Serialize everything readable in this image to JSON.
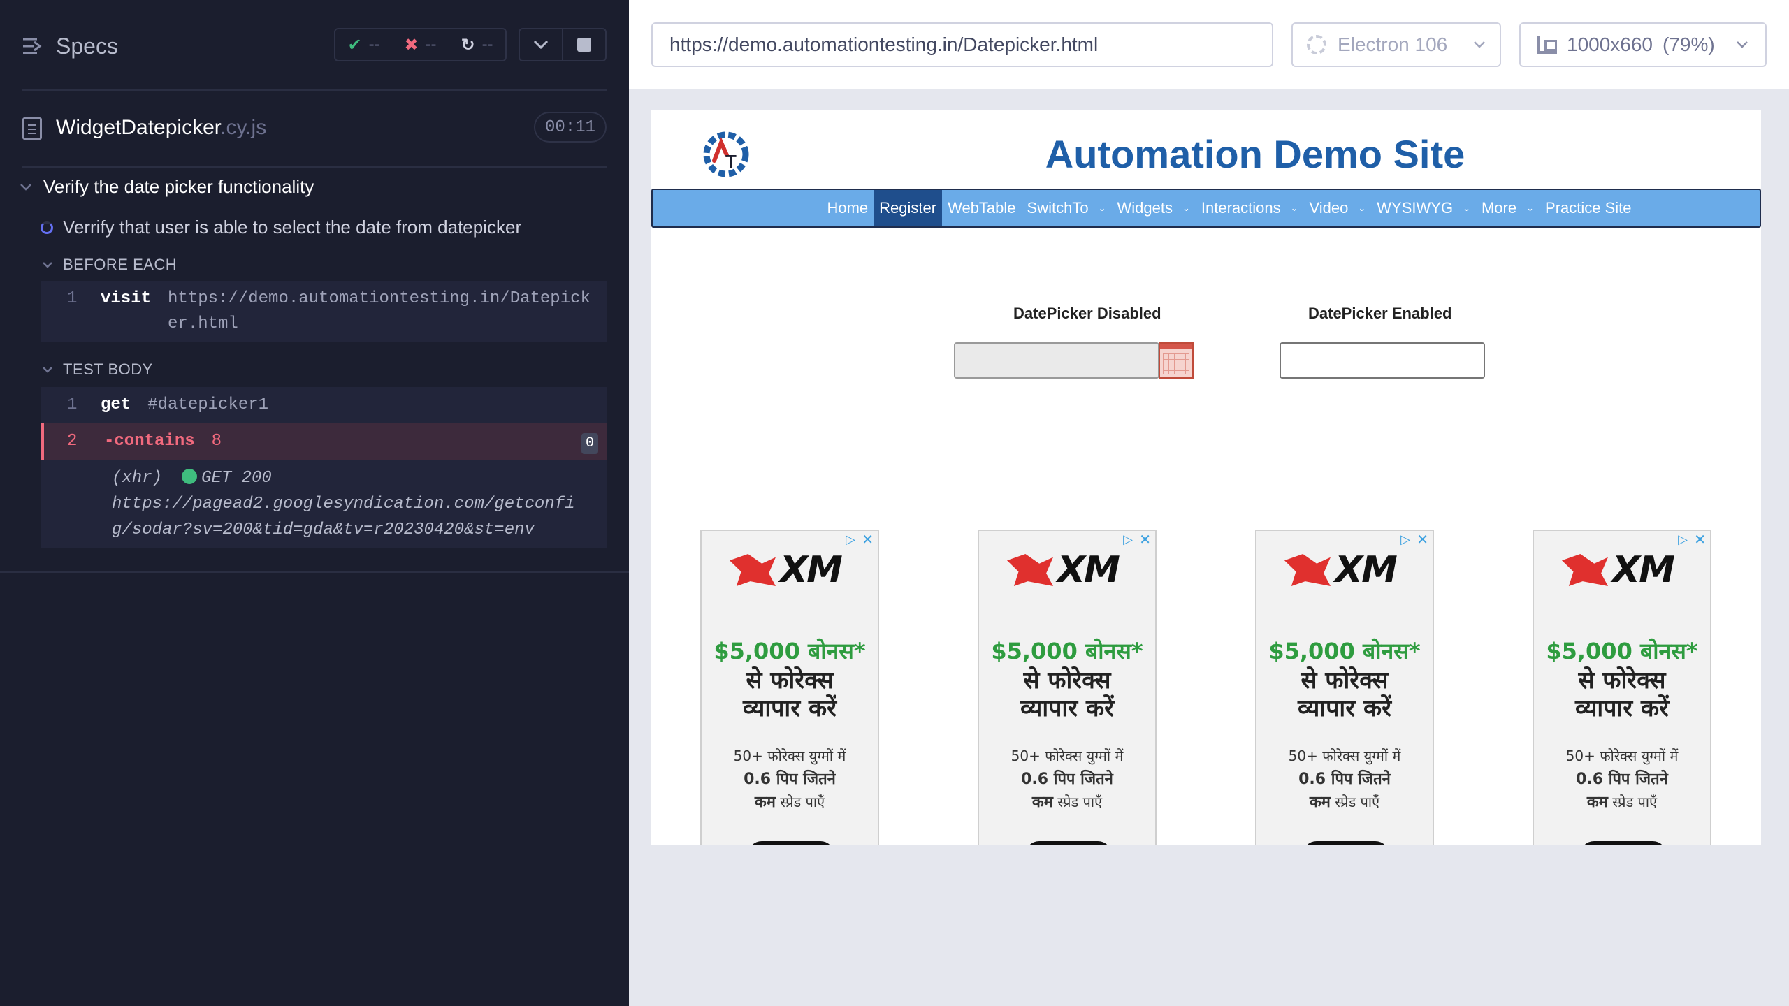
{
  "reporter": {
    "title": "Specs",
    "stats": {
      "passed": "--",
      "failed": "--",
      "pending": "--"
    },
    "spec": {
      "name": "WidgetDatepicker",
      "ext": ".cy.js",
      "duration": "00:11"
    },
    "suite_title": "Verify the date picker functionality",
    "test_title": "Verrify that user is able to select the date from datepicker",
    "before_each": {
      "label": "BEFORE EACH",
      "commands": [
        {
          "num": "1",
          "name": "visit",
          "message": "https://demo.automationtesting.in/Datepicker.html"
        }
      ]
    },
    "test_body": {
      "label": "TEST BODY",
      "commands": [
        {
          "num": "1",
          "name": "get",
          "message": "#datepicker1"
        },
        {
          "num": "2",
          "name": "-contains",
          "message": "8",
          "badge": "0"
        }
      ],
      "xhr": {
        "type": "(xhr)",
        "status": "GET 200",
        "url": "https://pagead2.googlesyndication.com/getconfig/sodar?sv=200&tid=gda&tv=r20230420&st=env"
      }
    }
  },
  "aut_header": {
    "url": "https://demo.automationtesting.in/Datepicker.html",
    "browser": "Electron 106",
    "viewport": "1000x660",
    "zoom": "(79%)"
  },
  "site": {
    "title": "Automation Demo Site",
    "nav": [
      {
        "label": "Home",
        "dropdown": false
      },
      {
        "label": "Register",
        "dropdown": false,
        "active": true
      },
      {
        "label": "WebTable",
        "dropdown": false
      },
      {
        "label": "SwitchTo",
        "dropdown": true
      },
      {
        "label": "Widgets",
        "dropdown": true
      },
      {
        "label": "Interactions",
        "dropdown": true
      },
      {
        "label": "Video",
        "dropdown": true
      },
      {
        "label": "WYSIWYG",
        "dropdown": true
      },
      {
        "label": "More",
        "dropdown": true
      },
      {
        "label": "Practice Site",
        "dropdown": false
      }
    ],
    "datepicker_disabled_label": "DatePicker Disabled",
    "datepicker_enabled_label": "DatePicker Enabled",
    "ad": {
      "brand": "XM",
      "bonus": "$5,000 बोनस*",
      "headline_1": "से फोरेक्स",
      "headline_2": "व्यापार करें",
      "sub_1": "50+ फोरेक्स युग्मों में",
      "sub_2": "0.6 पिप जितने",
      "sub_3_bold": "कम",
      "sub_3_rest": " स्प्रेड पाएँ"
    }
  },
  "colors": {
    "reporter_bg": "#1b1e2e",
    "active_cmd": "#f26a7e",
    "passed": "#3fbc7e",
    "site_title": "#1f5fa8",
    "navbar": "#6aabe8"
  }
}
